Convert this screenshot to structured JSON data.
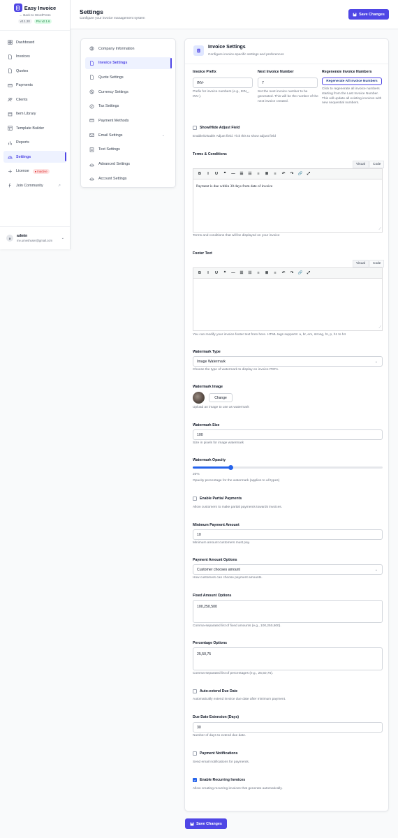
{
  "brand": {
    "name": "Easy Invoice",
    "back": "← Back to WordPress",
    "version": "v2.1.20",
    "pro": "Pro v2.1.6"
  },
  "sidebar": {
    "items": [
      {
        "label": "Dashboard",
        "icon": "grid-icon"
      },
      {
        "label": "Invoices",
        "icon": "file-icon"
      },
      {
        "label": "Quotes",
        "icon": "file-icon"
      },
      {
        "label": "Payments",
        "icon": "card-icon"
      },
      {
        "label": "Clients",
        "icon": "users-icon"
      },
      {
        "label": "Item Library",
        "icon": "box-icon"
      },
      {
        "label": "Template Builder",
        "icon": "layout-icon"
      },
      {
        "label": "Reports",
        "icon": "chart-icon"
      },
      {
        "label": "Settings",
        "icon": "gear-icon",
        "active": true
      },
      {
        "label": "License",
        "icon": "plus-icon",
        "badge": "● Inactive"
      },
      {
        "label": "Join Community",
        "icon": "facebook-icon",
        "external": "↗"
      }
    ]
  },
  "user": {
    "initial": "a",
    "name": "admin",
    "email": "me.umeshuser@gmail.com"
  },
  "header": {
    "title": "Settings",
    "subtitle": "Configure your invoice management system",
    "save_label": "Save Changes"
  },
  "settings_menu": [
    {
      "label": "Company Information",
      "icon": "building-icon"
    },
    {
      "label": "Invoice Settings",
      "icon": "file-icon",
      "active": true
    },
    {
      "label": "Quote Settings",
      "icon": "file-icon"
    },
    {
      "label": "Currency Settings",
      "icon": "currency-icon"
    },
    {
      "label": "Tax Settings",
      "icon": "percent-icon"
    },
    {
      "label": "Payment Methods",
      "icon": "card-icon"
    },
    {
      "label": "Email Settings",
      "icon": "mail-icon",
      "expand": "⌄"
    },
    {
      "label": "Text Settings",
      "icon": "text-icon"
    },
    {
      "label": "Advanced Settings",
      "icon": "sliders-icon"
    },
    {
      "label": "Account Settings",
      "icon": "user-icon"
    }
  ],
  "panel": {
    "title": "Invoice Settings",
    "subtitle": "Configure invoice-specific settings and preferences",
    "prefix": {
      "label": "Invoice Prefix",
      "value": "INV-",
      "help": "Prefix for invoice numbers (e.g., EIN_, INV-)."
    },
    "next_number": {
      "label": "Next Invoice Number",
      "value": "7",
      "help": "Set the next invoice number to be generated. This will be the number of the next invoice created."
    },
    "regenerate": {
      "label": "Regenerate Invoice Numbers",
      "button": "Regenerate All Invoice Numbers",
      "help": "Click to regenerate all invoice numbers starting from the Last Invoice Number. This will update all existing invoices with new sequential numbers."
    },
    "adjust": {
      "label": "Show/Hide Adjust Field",
      "help": "Enable/Disable Adjust field. Tick this to show adjust field",
      "checked": false
    },
    "terms": {
      "label": "Terms & Conditions",
      "tab_visual": "Visual",
      "tab_code": "Code",
      "content": "Payment is due within 30 days from date of invoice",
      "help": "Terms and conditions that will be displayed on your invoice"
    },
    "footer": {
      "label": "Footer Text",
      "tab_visual": "Visual",
      "tab_code": "Code",
      "content": "",
      "help": "You can modify your invoice footer text from here. HTML tags supports: a, br, em, strong, hr, p, h1 to h4"
    },
    "toolbar": [
      "B",
      "I",
      "U",
      "❝",
      "—",
      "☰",
      "☷",
      "≡",
      "≣",
      "≡",
      "↶",
      "↷",
      "🔗",
      "⤢"
    ],
    "wm_type": {
      "label": "Watermark Type",
      "value": "Image Watermark",
      "help": "Choose the type of watermark to display on invoice PDFs."
    },
    "wm_image": {
      "label": "Watermark Image",
      "button": "Change",
      "help": "Upload an image to use as watermark"
    },
    "wm_size": {
      "label": "Watermark Size",
      "value": "100",
      "help": "Size in pixels for image watermark"
    },
    "wm_opacity": {
      "label": "Watermark Opacity",
      "value": 20,
      "value_text": "20%",
      "help": "Opacity percentage for the watermark (applies to all types)"
    },
    "partial": {
      "label": "Enable Partial Payments",
      "help": "Allow customers to make partial payments towards invoices.",
      "checked": false
    },
    "min_amount": {
      "label": "Minimum Payment Amount",
      "value": "10",
      "help": "Minimum amount customers must pay."
    },
    "amount_options": {
      "label": "Payment Amount Options",
      "value": "Customer chooses amount",
      "help": "How customers can choose payment amounts."
    },
    "fixed_options": {
      "label": "Fixed Amount Options",
      "value": "100,250,500",
      "help": "Comma-separated list of fixed amounts (e.g., 100,250,500)."
    },
    "percent_options": {
      "label": "Percentage Options",
      "value": "25,50,75",
      "help": "Comma-separated list of percentages (e.g., 25,50,75)."
    },
    "auto_extend": {
      "label": "Auto-extend Due Date",
      "help": "Automatically extend invoice due date after minimum payment.",
      "checked": false
    },
    "extension_days": {
      "label": "Due Date Extension (Days)",
      "value": "30",
      "help": "Number of days to extend due date."
    },
    "notifications": {
      "label": "Payment Notifications",
      "help": "Send email notifications for payments.",
      "checked": false
    },
    "recurring": {
      "label": "Enable Recurring Invoices",
      "help": "Allow creating recurring invoices that generate automatically.",
      "checked": true
    }
  },
  "footer_save": "Save Changes",
  "colors": {
    "accent": "#4f46e5",
    "checkbox": "#2563eb"
  }
}
